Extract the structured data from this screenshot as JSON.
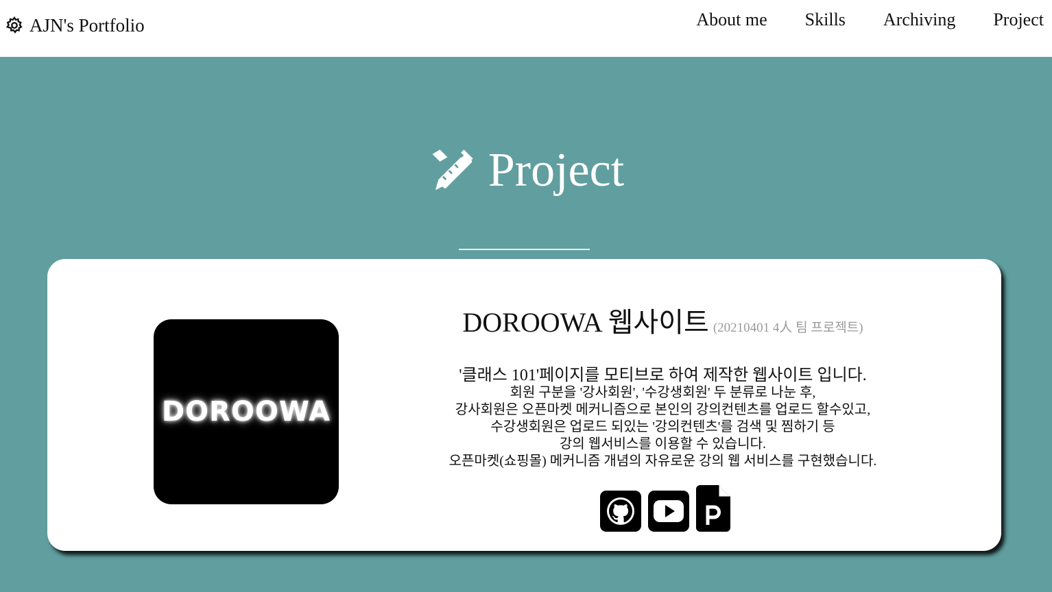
{
  "navbar": {
    "brand_icon": "gear-icon",
    "brand_text": "AJN's Portfolio",
    "links": [
      "About me",
      "Skills",
      "Archiving",
      "Project"
    ]
  },
  "section": {
    "icon": "pencil-ruler-icon",
    "title": "Project"
  },
  "project": {
    "logo_text": "DOROOWA",
    "name": "DOROOWA 웹사이트",
    "meta": "(20210401 4人 팀 프로젝트)",
    "description_lines": [
      "'클래스 101'페이지를 모티브로 하여 제작한 웹사이트 입니다.",
      "회원 구분을 '강사회원', '수강생회원' 두 분류로 나눈 후,",
      "강사회원은 오픈마켓 메커니즘으로 본인의 강의컨텐츠를 업로드 할수있고,",
      "수강생회원은 업로드 되있는 '강의컨텐츠'를 검색 및 찜하기 등",
      "강의 웹서비스를 이용할 수 있습니다.",
      "오픈마켓(쇼핑몰) 메커니즘 개념의 자유로운 강의 웹 서비스를 구현했습니다."
    ],
    "links": [
      {
        "icon": "github-icon"
      },
      {
        "icon": "youtube-icon"
      },
      {
        "icon": "ppt-file-icon"
      }
    ]
  },
  "colors": {
    "background": "#619e9f",
    "card": "#ffffff",
    "meta_text": "#9a9a9a"
  }
}
